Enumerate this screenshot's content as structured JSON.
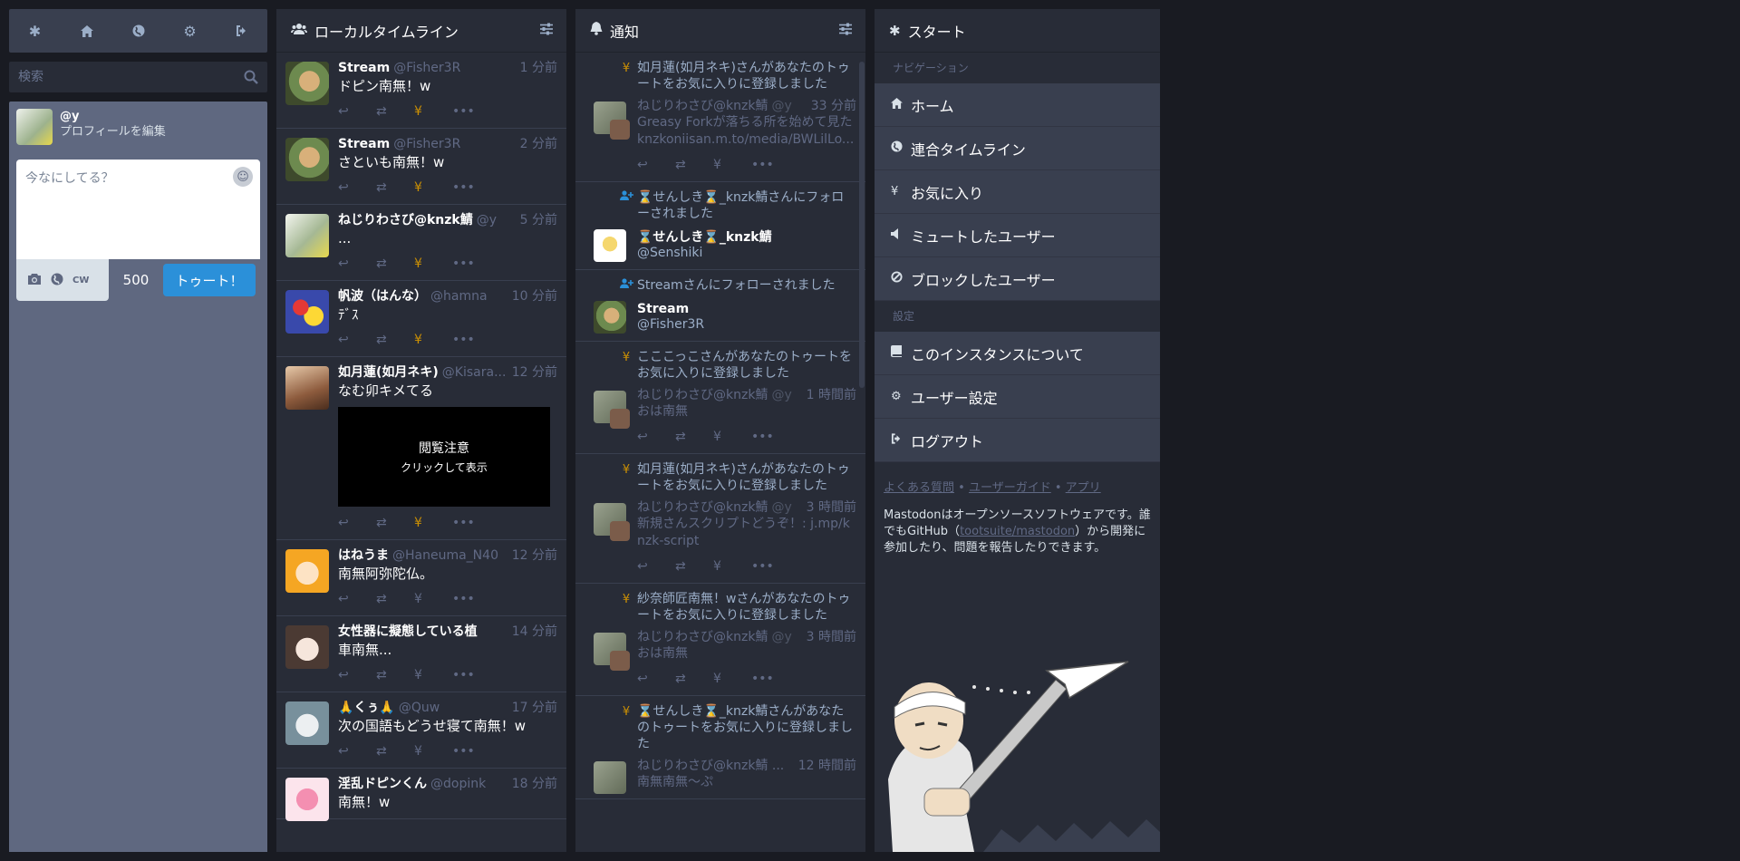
{
  "drawer": {
    "nav_icons": [
      "getting-started-icon",
      "home-icon",
      "globe-icon",
      "gear-icon",
      "logout-icon"
    ],
    "search_placeholder": "検索",
    "account": {
      "handle": "@y",
      "edit_label": "プロフィールを編集"
    },
    "compose": {
      "placeholder": "今なにしてる？",
      "cw_label": "CW",
      "char_count": "500",
      "toot_label": "トゥート！"
    }
  },
  "local": {
    "title": "ローカルタイムライン",
    "statuses": [
      {
        "name": "Stream",
        "handle": "@Fisher3R",
        "time": "1 分前",
        "content": "ドピン南無！w"
      },
      {
        "name": "Stream",
        "handle": "@Fisher3R",
        "time": "2 分前",
        "content": "さといも南無！w"
      },
      {
        "name": "ねじりわさび@knzk鯖",
        "handle": "@y",
        "time": "5 分前",
        "content": "..."
      },
      {
        "name": "帆波（はんな）",
        "handle": "@hamna",
        "time": "10 分前",
        "content": "ﾃﾞｽ"
      },
      {
        "name": "如月蓮(如月ネキ)",
        "handle": "@Kisara...",
        "time": "12 分前",
        "content": "なむ卯キメてる",
        "sensitive_title": "閲覧注意",
        "sensitive_sub": "クリックして表示"
      },
      {
        "name": "はねうま",
        "handle": "@Haneuma_N40",
        "time": "12 分前",
        "content": "南無阿弥陀仏。"
      },
      {
        "name": "女性器に擬態している植",
        "handle": "",
        "time": "14 分前",
        "content": "車南無..."
      },
      {
        "name": "🙏くぅ🙏",
        "handle": "@Quw",
        "time": "17 分前",
        "content": "次の国語もどうせ寝て南無！w"
      },
      {
        "name": "淫乱ドピンくん",
        "handle": "@dopink",
        "time": "18 分前",
        "content": "南無！w"
      }
    ]
  },
  "notifications": {
    "title": "通知",
    "items": [
      {
        "type": "favourite",
        "text": "如月蓮(如月ネキ)さんがあなたのトゥートをお気に入りに登録しました",
        "name": "ねじりわさび@knzk鯖",
        "handle": "@y",
        "time": "33 分前",
        "content": "Greasy Forkが落ちる所を始めて見た knzkoniisan.m.to/media/BWLilLo..."
      },
      {
        "type": "follow",
        "text": "⌛せんしき⌛_knzk鯖さんにフォローされました",
        "acct_name": "⌛せんしき⌛_knzk鯖",
        "acct_handle": "@Senshiki"
      },
      {
        "type": "follow",
        "text": "Streamさんにフォローされました",
        "acct_name": "Stream",
        "acct_handle": "@Fisher3R"
      },
      {
        "type": "favourite",
        "text": "こここっこさんがあなたのトゥートをお気に入りに登録しました",
        "name": "ねじりわさび@knzk鯖",
        "handle": "@y",
        "time": "1 時間前",
        "content": "おは南無"
      },
      {
        "type": "favourite",
        "text": "如月蓮(如月ネキ)さんがあなたのトゥートをお気に入りに登録しました",
        "name": "ねじりわさび@knzk鯖",
        "handle": "@y",
        "time": "3 時間前",
        "content": "新規さんスクリプトどうぞ！: j.mp/knzk-script"
      },
      {
        "type": "favourite",
        "text": "紗奈師匠南無！wさんがあなたのトゥートをお気に入りに登録しました",
        "name": "ねじりわさび@knzk鯖",
        "handle": "@y",
        "time": "3 時間前",
        "content": "おは南無"
      },
      {
        "type": "favourite",
        "text": "⌛せんしき⌛_knzk鯖さんがあなたのトゥートをお気に入りに登録しました",
        "name": "ねじりわさび@knzk鯖 ...",
        "handle": "",
        "time": "12 時間前",
        "content": "南無南無～ぷ"
      }
    ]
  },
  "start": {
    "title": "スタート",
    "nav_header": "ナビゲーション",
    "nav_items": [
      "ホーム",
      "連合タイムライン",
      "お気に入り",
      "ミュートしたユーザー",
      "ブロックしたユーザー"
    ],
    "settings_header": "設定",
    "settings_items": [
      "このインスタンスについて",
      "ユーザー設定",
      "ログアウト"
    ],
    "links": {
      "faq": "よくある質問",
      "guide": "ユーザーガイド",
      "apps": "アプリ",
      "sep": "•"
    },
    "about_text_1": "Mastodonはオープンソースソフトウェアです。誰でもGitHub（",
    "about_link": "tootsuite/mastodon",
    "about_text_2": "）から開発に参加したり、問題を報告したりできます。"
  },
  "colors": {
    "accent": "#2b90d9",
    "favourite": "#ca8f04",
    "panel": "#282c37"
  }
}
